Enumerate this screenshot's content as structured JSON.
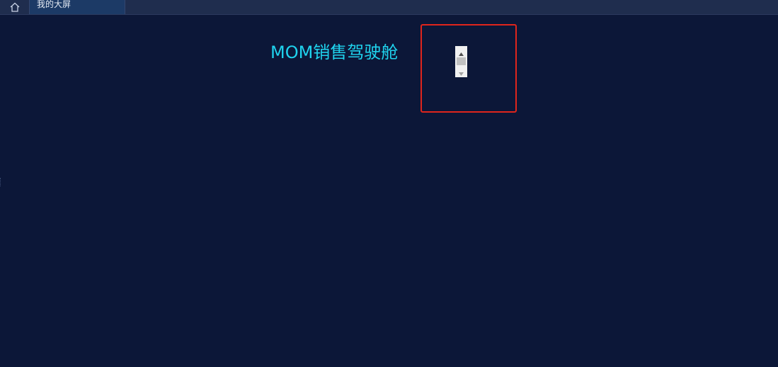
{
  "tabbar": {
    "home_icon": "home-icon",
    "tabs": [
      {
        "label": "我的大屏"
      }
    ]
  },
  "dashboard": {
    "title": "MOM销售驾驶舱"
  },
  "colors": {
    "background": "#0c1738",
    "tabbar": "#1f2d4e",
    "active_tab": "#1c3a66",
    "title": "#1fd3ee",
    "highlight_border": "#e0251c"
  }
}
